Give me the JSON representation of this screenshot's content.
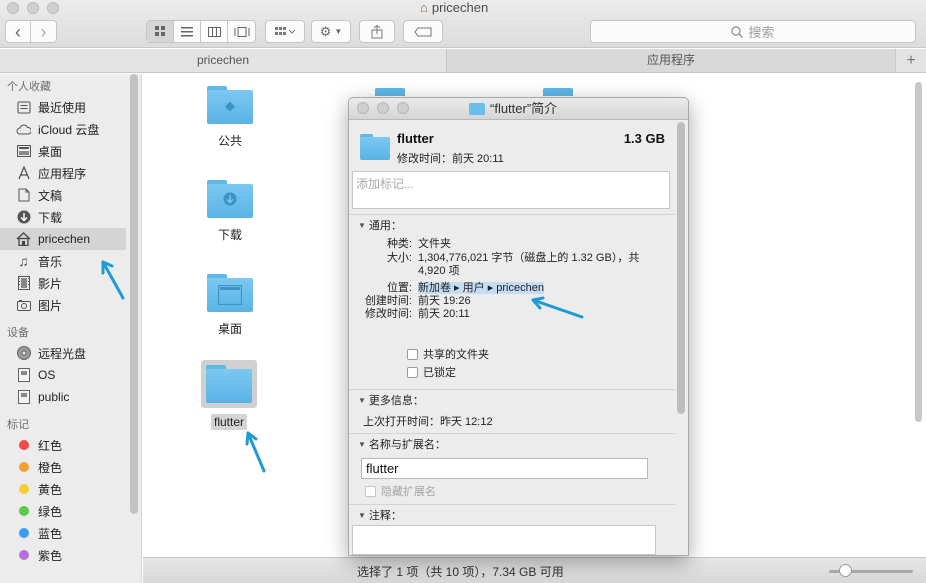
{
  "window": {
    "title": "pricechen",
    "back_label": "‹",
    "forward_label": "›",
    "search_placeholder": "搜索"
  },
  "path_tabs": [
    {
      "label": "pricechen"
    },
    {
      "label": "应用程序"
    }
  ],
  "tab_add_label": "+",
  "sidebar": {
    "favorites_heading": "个人收藏",
    "favorites": [
      {
        "label": "最近使用",
        "icon": "recents-icon"
      },
      {
        "label": "iCloud 云盘",
        "icon": "cloud-icon"
      },
      {
        "label": "桌面",
        "icon": "desktop-icon"
      },
      {
        "label": "应用程序",
        "icon": "applications-icon"
      },
      {
        "label": "文稿",
        "icon": "documents-icon"
      },
      {
        "label": "下载",
        "icon": "downloads-icon"
      },
      {
        "label": "pricechen",
        "icon": "home-icon",
        "selected": true
      },
      {
        "label": "音乐",
        "icon": "music-icon"
      },
      {
        "label": "影片",
        "icon": "movies-icon"
      },
      {
        "label": "图片",
        "icon": "pictures-icon"
      }
    ],
    "devices_heading": "设备",
    "devices": [
      {
        "label": "远程光盘",
        "icon": "disc-icon"
      },
      {
        "label": "OS",
        "icon": "drive-icon"
      },
      {
        "label": "public",
        "icon": "drive-icon"
      }
    ],
    "tags_heading": "标记",
    "tags": [
      {
        "label": "红色",
        "color": "#f04a46"
      },
      {
        "label": "橙色",
        "color": "#f5a032"
      },
      {
        "label": "黄色",
        "color": "#f5cd30"
      },
      {
        "label": "绿色",
        "color": "#5cc94c"
      },
      {
        "label": "蓝色",
        "color": "#3b9cf0"
      },
      {
        "label": "紫色",
        "color": "#b56de0"
      }
    ]
  },
  "files": [
    {
      "label": "公共"
    },
    {
      "label": "下载"
    },
    {
      "label": "桌面"
    },
    {
      "label": "flutter"
    }
  ],
  "status": {
    "text": "选择了 1 项（共 10 项），7.34 GB 可用"
  },
  "info_window": {
    "title": "“flutter”简介",
    "name": "flutter",
    "size": "1.3 GB",
    "modified_summary": "修改时间：前天 20:11",
    "tags_placeholder": "添加标记...",
    "general_heading": "通用：",
    "general": {
      "kind_label": "种类:",
      "kind_value": "文件夹",
      "size_label": "大小:",
      "size_value": "1,304,776,021 字节（磁盘上的 1.32 GB），共 4,920 项",
      "where_label": "位置:",
      "where_value": "新加卷 ▸ 用户 ▸ pricechen",
      "created_label": "创建时间:",
      "created_value": "前天 19:26",
      "modified_label": "修改时间:",
      "modified_value": "前天 20:11"
    },
    "shared_folder_label": "共享的文件夹",
    "locked_label": "已锁定",
    "more_info_heading": "更多信息：",
    "last_opened_label": "上次打开时间：",
    "last_opened_value": "昨天 12:12",
    "name_ext_heading": "名称与扩展名：",
    "name_value": "flutter",
    "hide_ext_label": "隐藏扩展名",
    "comments_heading": "注释："
  },
  "colors": {
    "arrow": "#1e9ad6",
    "folder": "#6bbdec",
    "selection_highlight": "#c5dcf5"
  }
}
